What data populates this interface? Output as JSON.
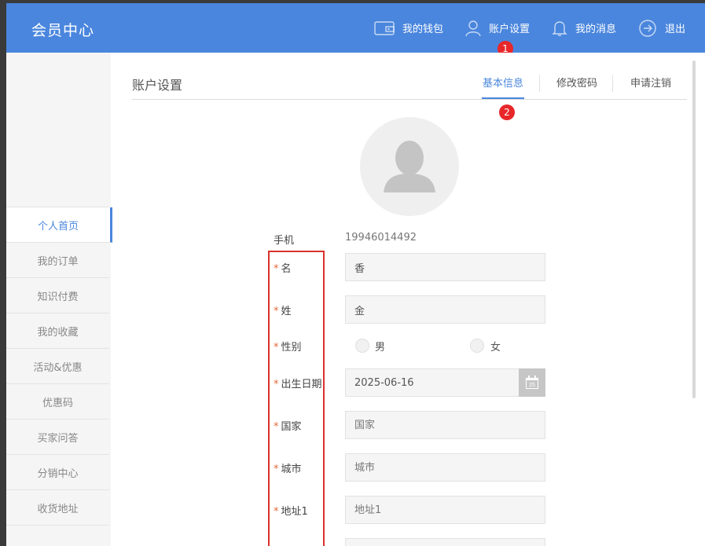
{
  "header": {
    "brand": "会员中心",
    "nav": [
      {
        "label": "我的钱包",
        "icon": "wallet-icon"
      },
      {
        "label": "账户设置",
        "icon": "user-icon"
      },
      {
        "label": "我的消息",
        "icon": "bell-icon"
      },
      {
        "label": "退出",
        "icon": "logout-icon"
      }
    ],
    "badge": "1"
  },
  "sidebar": {
    "items": [
      {
        "label": "个人首页",
        "active": true
      },
      {
        "label": "我的订单"
      },
      {
        "label": "知识付费"
      },
      {
        "label": "我的收藏"
      },
      {
        "label": "活动&优惠"
      },
      {
        "label": "优惠码"
      },
      {
        "label": "买家问答"
      },
      {
        "label": "分销中心"
      },
      {
        "label": "收货地址"
      }
    ]
  },
  "main": {
    "title": "账户设置",
    "tabs": [
      {
        "label": "基本信息",
        "active": true
      },
      {
        "label": "修改密码"
      },
      {
        "label": "申请注销"
      }
    ],
    "tab_badge": "2",
    "form": {
      "phone_label": "手机",
      "phone_value": "19946014492",
      "required_mark": "*",
      "first_name": {
        "label": "名",
        "value": "香"
      },
      "last_name": {
        "label": "姓",
        "value": "金"
      },
      "gender": {
        "label": "性别",
        "options": [
          "男",
          "女"
        ]
      },
      "birthday": {
        "label": "出生日期",
        "value": "2025-06-16",
        "calendar_day": "25"
      },
      "country": {
        "label": "国家",
        "placeholder": "国家"
      },
      "city": {
        "label": "城市",
        "placeholder": "城市"
      },
      "address1": {
        "label": "地址1",
        "placeholder": "地址1"
      }
    }
  },
  "colors": {
    "accent": "#4a86dd",
    "required": "#e46a3a",
    "badge": "#e8272a",
    "highlight": "#d9322c"
  }
}
